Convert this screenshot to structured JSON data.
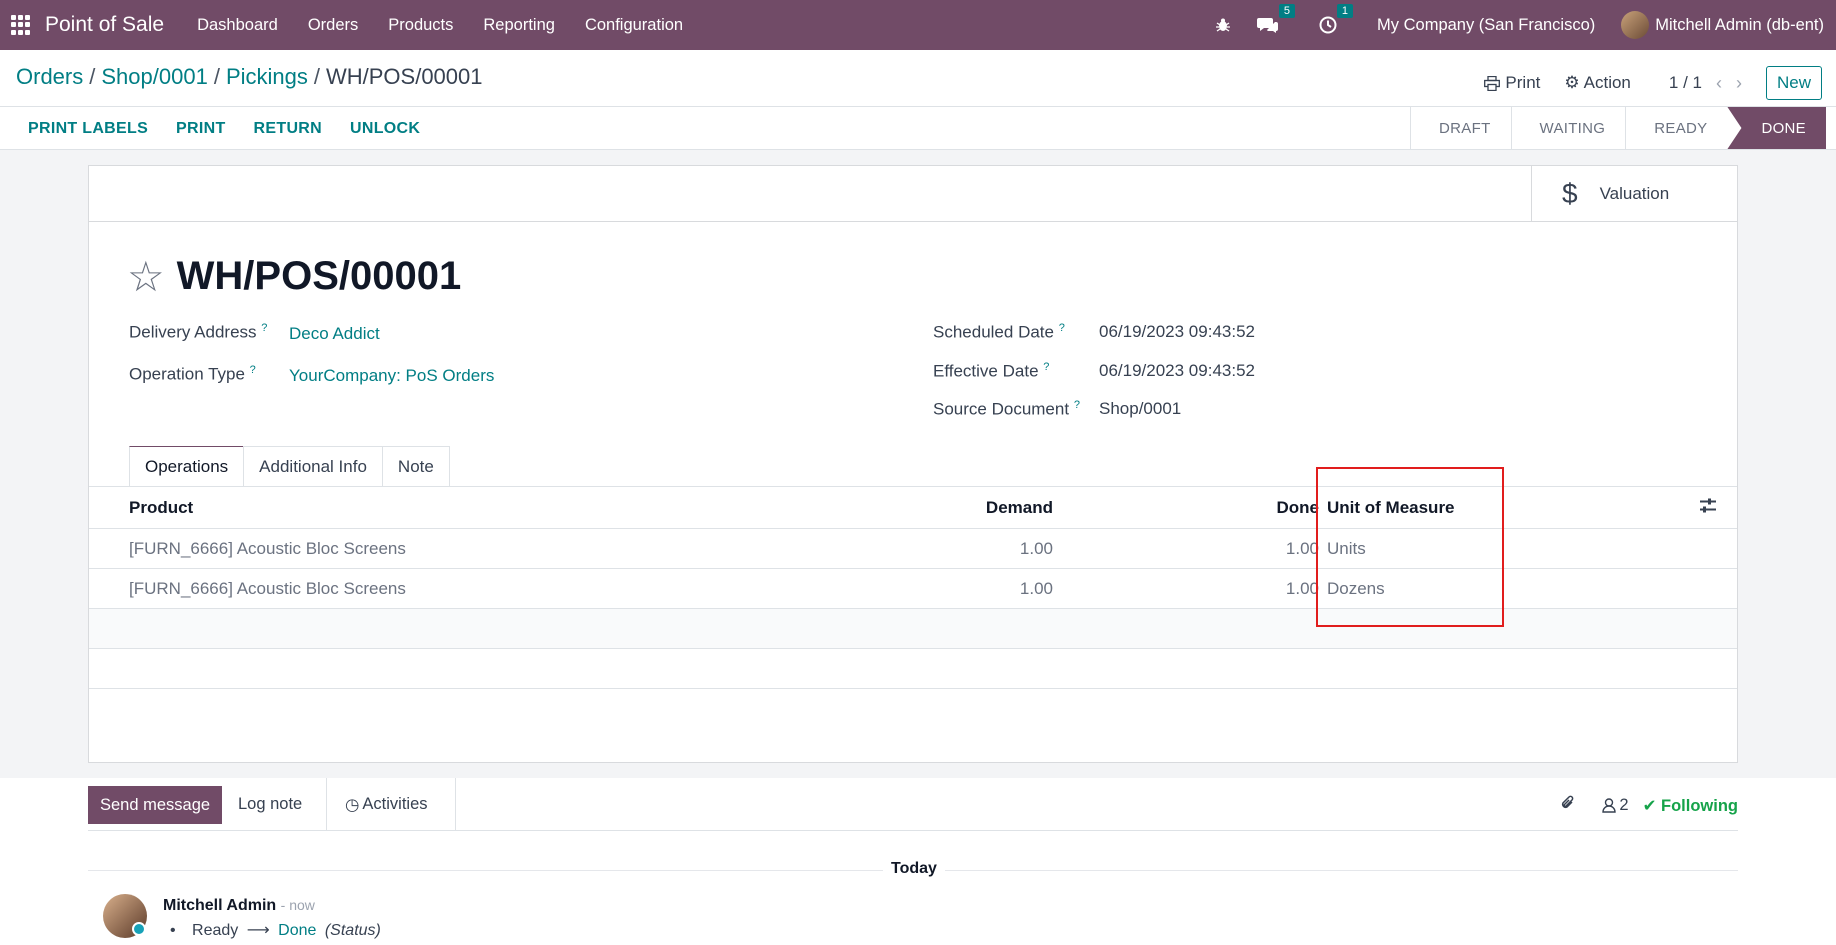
{
  "navbar": {
    "app_name": "Point of Sale",
    "menus": [
      "Dashboard",
      "Orders",
      "Products",
      "Reporting",
      "Configuration"
    ],
    "messages_badge": "5",
    "activities_badge": "1",
    "company": "My Company (San Francisco)",
    "user": "Mitchell Admin (db-ent)"
  },
  "breadcrumb": {
    "items": [
      "Orders",
      "Shop/0001",
      "Pickings"
    ],
    "current": "WH/POS/00001"
  },
  "control": {
    "print_label": "Print",
    "action_label": "Action",
    "pager": "1 / 1",
    "new_label": "New"
  },
  "actions": [
    "PRINT LABELS",
    "PRINT",
    "RETURN",
    "UNLOCK"
  ],
  "statusbar": {
    "stages": [
      "DRAFT",
      "WAITING",
      "READY",
      "DONE"
    ],
    "active": "DONE"
  },
  "smart_button": {
    "label": "Valuation"
  },
  "record": {
    "title": "WH/POS/00001",
    "delivery_address_label": "Delivery Address",
    "delivery_address": "Deco Addict",
    "operation_type_label": "Operation Type",
    "operation_type": "YourCompany: PoS Orders",
    "scheduled_date_label": "Scheduled Date",
    "scheduled_date": "06/19/2023 09:43:52",
    "effective_date_label": "Effective Date",
    "effective_date": "06/19/2023 09:43:52",
    "source_document_label": "Source Document",
    "source_document": "Shop/0001",
    "help_marker": "?"
  },
  "tabs": [
    "Operations",
    "Additional Info",
    "Note"
  ],
  "operations": {
    "columns": [
      "Product",
      "Demand",
      "Done",
      "Unit of Measure"
    ],
    "rows": [
      {
        "product": "[FURN_6666] Acoustic Bloc Screens",
        "demand": "1.00",
        "done": "1.00",
        "uom": "Units"
      },
      {
        "product": "[FURN_6666] Acoustic Bloc Screens",
        "demand": "1.00",
        "done": "1.00",
        "uom": "Dozens"
      }
    ]
  },
  "chatter": {
    "send_message": "Send message",
    "log_note": "Log note",
    "activities": "Activities",
    "followers_count": "2",
    "following": "Following",
    "today": "Today",
    "message": {
      "author": "Mitchell Admin",
      "time": "- now",
      "from_state": "Ready",
      "to_state": "Done",
      "field": "(Status)"
    }
  },
  "colors": {
    "brand": "#714b67",
    "link": "#017e84",
    "highlight": "#e11d1d"
  }
}
